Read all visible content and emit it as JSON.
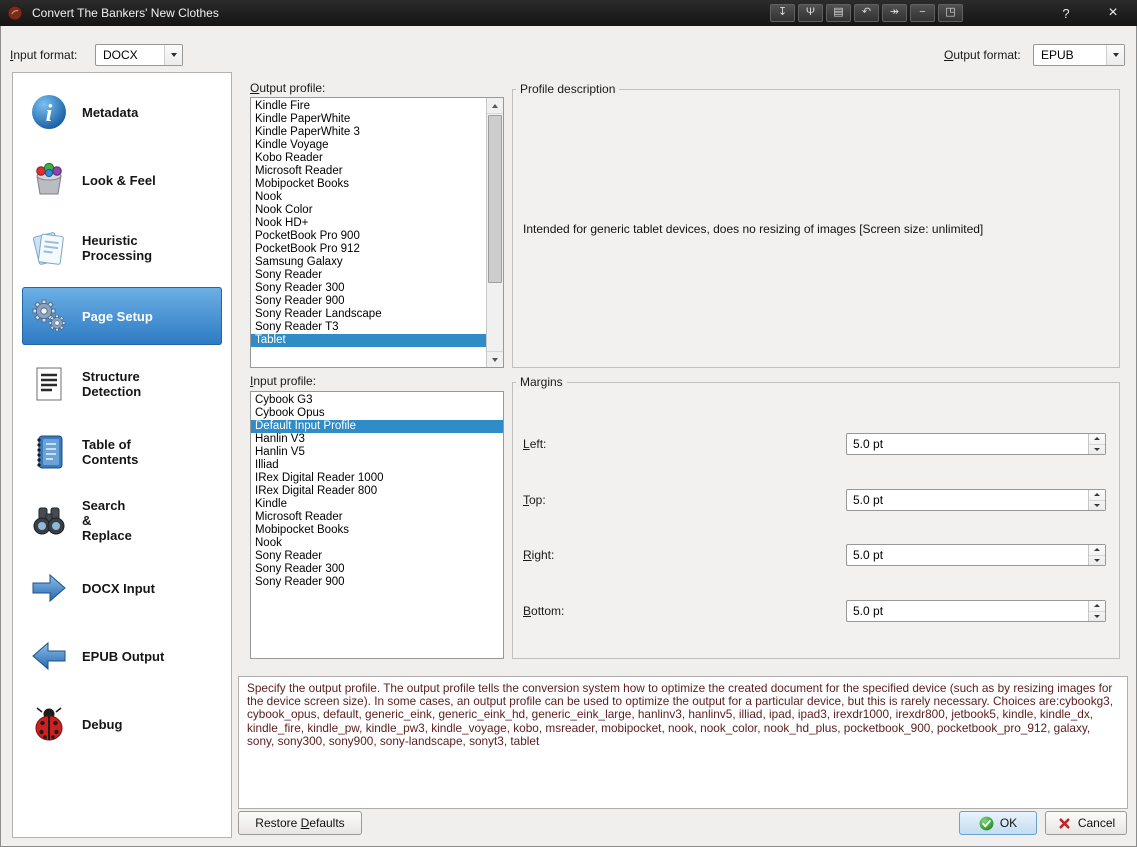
{
  "window": {
    "title": "Convert The Bankers' New Clothes",
    "help": "?",
    "close": "×",
    "toolbar": [
      {
        "name": "send-down-icon",
        "glyph": "↧"
      },
      {
        "name": "connect-icon",
        "glyph": "Ψ"
      },
      {
        "name": "keyboard-icon",
        "glyph": "▤"
      },
      {
        "name": "undo-icon",
        "glyph": "↶"
      },
      {
        "name": "forward-icon",
        "glyph": "↠"
      },
      {
        "name": "minimize-icon",
        "glyph": "−"
      },
      {
        "name": "window-mode-icon",
        "glyph": "◳"
      }
    ]
  },
  "colors": {
    "accent": "#308cc6",
    "sidebar_selected_top": "#6cb0e6",
    "sidebar_selected_bottom": "#2d7ac2",
    "titlebar": "#1c1c1c",
    "help_text": "#5b1d1d"
  },
  "format_bar": {
    "input_label": "Input format:",
    "input_value": "DOCX",
    "output_label": "Output format:",
    "output_value": "EPUB"
  },
  "sidebar": {
    "items": [
      {
        "label": "Metadata",
        "icon": "info-icon"
      },
      {
        "label": "Look & Feel",
        "icon": "palette-icon"
      },
      {
        "label": "Heuristic\nProcessing",
        "icon": "pages-icon"
      },
      {
        "label": "Page Setup",
        "icon": "gears-icon",
        "selected": true
      },
      {
        "label": "Structure\nDetection",
        "icon": "document-lines-icon"
      },
      {
        "label": "Table of\nContents",
        "icon": "notebook-icon"
      },
      {
        "label": "Search\n&\nReplace",
        "icon": "binoculars-icon"
      },
      {
        "label": "DOCX Input",
        "icon": "arrow-right-icon"
      },
      {
        "label": "EPUB Output",
        "icon": "arrow-left-icon"
      },
      {
        "label": "Debug",
        "icon": "ladybug-icon"
      }
    ]
  },
  "output_profile": {
    "label": "Output profile:",
    "selected": "Tablet",
    "items": [
      "Kindle Fire",
      "Kindle PaperWhite",
      "Kindle PaperWhite 3",
      "Kindle Voyage",
      "Kobo Reader",
      "Microsoft Reader",
      "Mobipocket Books",
      "Nook",
      "Nook Color",
      "Nook HD+",
      "PocketBook Pro 900",
      "PocketBook Pro 912",
      "Samsung Galaxy",
      "Sony Reader",
      "Sony Reader 300",
      "Sony Reader 900",
      "Sony Reader Landscape",
      "Sony Reader T3",
      "Tablet"
    ]
  },
  "profile_description": {
    "label": "Profile description",
    "text": "Intended for generic tablet devices, does no resizing of images [Screen size: unlimited]"
  },
  "input_profile": {
    "label": "Input profile:",
    "selected": "Default Input Profile",
    "items": [
      "Cybook G3",
      "Cybook Opus",
      "Default Input Profile",
      "Hanlin V3",
      "Hanlin V5",
      "Illiad",
      "IRex Digital Reader 1000",
      "IRex Digital Reader 800",
      "Kindle",
      "Microsoft Reader",
      "Mobipocket Books",
      "Nook",
      "Sony Reader",
      "Sony Reader 300",
      "Sony Reader 900"
    ]
  },
  "margins": {
    "label": "Margins",
    "fields": [
      {
        "label": "Left:",
        "value": "5.0 pt"
      },
      {
        "label": "Top:",
        "value": "5.0 pt"
      },
      {
        "label": "Right:",
        "value": "5.0 pt"
      },
      {
        "label": "Bottom:",
        "value": "5.0 pt"
      }
    ]
  },
  "help_text": "Specify the output profile. The output profile tells the conversion system how to optimize the created document for the specified device (such as by resizing images for the device screen size). In some cases, an output profile can be used to optimize the output for a particular device, but this is rarely necessary. Choices are:cybookg3, cybook_opus, default, generic_eink, generic_eink_hd, generic_eink_large, hanlinv3, hanlinv5, illiad, ipad, ipad3, irexdr1000, irexdr800, jetbook5, kindle, kindle_dx, kindle_fire, kindle_pw, kindle_pw3, kindle_voyage, kobo, msreader, mobipocket, nook, nook_color, nook_hd_plus, pocketbook_900, pocketbook_pro_912, galaxy, sony, sony300, sony900, sony-landscape, sonyt3, tablet",
  "footer": {
    "restore_defaults": "Restore Defaults",
    "ok": "OK",
    "cancel": "Cancel"
  }
}
